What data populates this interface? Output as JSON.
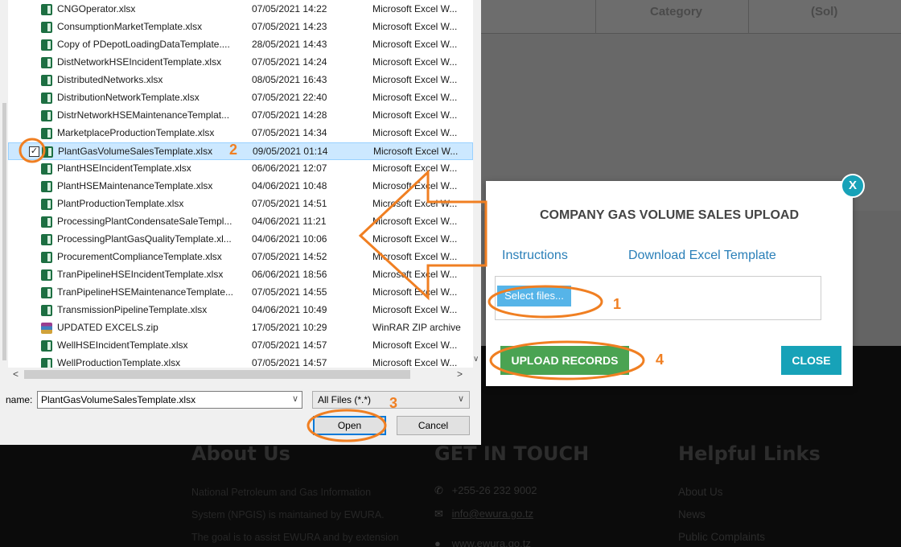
{
  "background": {
    "table_headers": [
      "Category",
      "(Sol)"
    ],
    "footer": {
      "about": {
        "heading": "About Us",
        "text": "National Petroleum and Gas Information System (NPGIS) is maintained by EWURA. The goal is to assist EWURA and by extension the Ministry of Energy in"
      },
      "contact": {
        "heading": "GET IN TOUCH",
        "phone": "+255-26 232 9002",
        "email": "info@ewura.go.tz",
        "website": "www.ewura.go.tz"
      },
      "links": {
        "heading": "Helpful Links",
        "items": [
          "About Us",
          "News",
          "Public Complaints"
        ]
      }
    }
  },
  "modal": {
    "title": "COMPANY GAS VOLUME SALES UPLOAD",
    "close_x": "X",
    "instructions_link": "Instructions",
    "template_link": "Download Excel Template",
    "select_files": "Select files...",
    "upload_button": "UPLOAD RECORDS",
    "close_button": "CLOSE"
  },
  "dialog": {
    "files": [
      {
        "name": "CNGOperator.xlsx",
        "date": "07/05/2021 14:22",
        "type": "Microsoft Excel W..."
      },
      {
        "name": "ConsumptionMarketTemplate.xlsx",
        "date": "07/05/2021 14:23",
        "type": "Microsoft Excel W..."
      },
      {
        "name": "Copy of PDepotLoadingDataTemplate....",
        "date": "28/05/2021 14:43",
        "type": "Microsoft Excel W..."
      },
      {
        "name": "DistNetworkHSEIncidentTemplate.xlsx",
        "date": "07/05/2021 14:24",
        "type": "Microsoft Excel W..."
      },
      {
        "name": "DistributedNetworks.xlsx",
        "date": "08/05/2021 16:43",
        "type": "Microsoft Excel W..."
      },
      {
        "name": "DistributionNetworkTemplate.xlsx",
        "date": "07/05/2021 22:40",
        "type": "Microsoft Excel W..."
      },
      {
        "name": "DistrNetworkHSEMaintenanceTemplat...",
        "date": "07/05/2021 14:28",
        "type": "Microsoft Excel W..."
      },
      {
        "name": "MarketplaceProductionTemplate.xlsx",
        "date": "07/05/2021 14:34",
        "type": "Microsoft Excel W..."
      },
      {
        "name": "PlantGasVolumeSalesTemplate.xlsx",
        "date": "09/05/2021 01:14",
        "type": "Microsoft Excel W...",
        "selected": true
      },
      {
        "name": "PlantHSEIncidentTemplate.xlsx",
        "date": "06/06/2021 12:07",
        "type": "Microsoft Excel W..."
      },
      {
        "name": "PlantHSEMaintenanceTemplate.xlsx",
        "date": "04/06/2021 10:48",
        "type": "Microsoft Excel W..."
      },
      {
        "name": "PlantProductionTemplate.xlsx",
        "date": "07/05/2021 14:51",
        "type": "Microsoft Excel W..."
      },
      {
        "name": "ProcessingPlantCondensateSaleTempl...",
        "date": "04/06/2021 11:21",
        "type": "Microsoft Excel W..."
      },
      {
        "name": "ProcessingPlantGasQualityTemplate.xl...",
        "date": "04/06/2021 10:06",
        "type": "Microsoft Excel W..."
      },
      {
        "name": "ProcurementComplianceTemplate.xlsx",
        "date": "07/05/2021 14:52",
        "type": "Microsoft Excel W..."
      },
      {
        "name": "TranPipelineHSEIncidentTemplate.xlsx",
        "date": "06/06/2021 18:56",
        "type": "Microsoft Excel W..."
      },
      {
        "name": "TranPipelineHSEMaintenanceTemplate...",
        "date": "07/05/2021 14:55",
        "type": "Microsoft Excel W..."
      },
      {
        "name": "TransmissionPipelineTemplate.xlsx",
        "date": "04/06/2021 10:49",
        "type": "Microsoft Excel W..."
      },
      {
        "name": "UPDATED EXCELS.zip",
        "date": "17/05/2021 10:29",
        "type": "WinRAR ZIP archive",
        "zip": true
      },
      {
        "name": "WellHSEIncidentTemplate.xlsx",
        "date": "07/05/2021 14:57",
        "type": "Microsoft Excel W..."
      },
      {
        "name": "WellProductionTemplate.xlsx",
        "date": "07/05/2021 14:57",
        "type": "Microsoft Excel W..."
      }
    ],
    "name_label": "name:",
    "name_value": "PlantGasVolumeSalesTemplate.xlsx",
    "filter_value": "All Files (*.*)",
    "open_button": "Open",
    "cancel_button": "Cancel"
  },
  "annotations": {
    "step_labels": [
      "1",
      "2",
      "3",
      "4"
    ],
    "color": "#f07f22"
  }
}
